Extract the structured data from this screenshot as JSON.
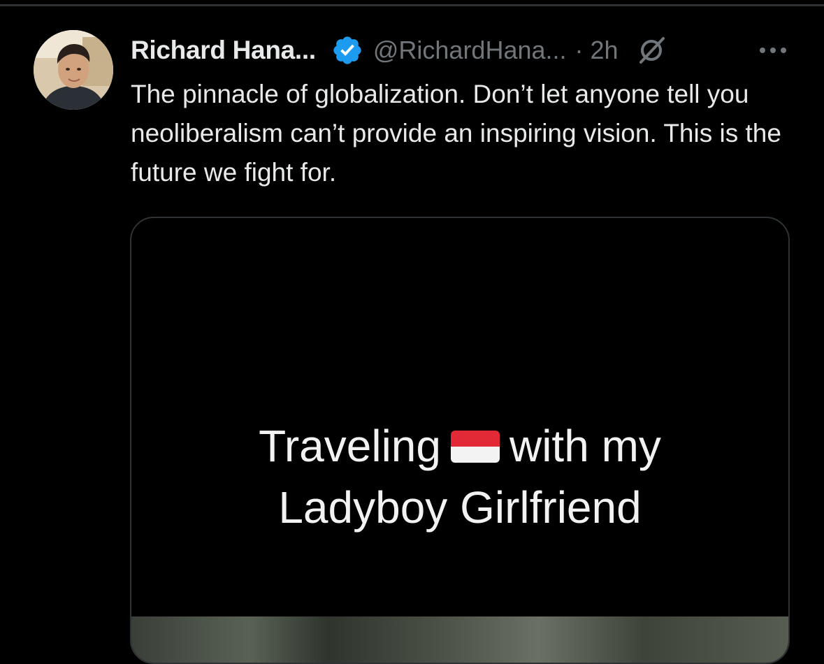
{
  "tweet": {
    "author": {
      "display_name": "Richard Hana...",
      "handle": "@RichardHana...",
      "verified": true,
      "verified_color": "#1d9bf0",
      "avatar_icon": "avatar-photo"
    },
    "separator": "·",
    "time": "2h",
    "grok_icon": "grok-icon",
    "more_icon": "more-horizontal-icon",
    "text": "The pinnacle of globalization. Don’t let anyone tell you neoliberalism can’t provide an inspiring vision. This is the future we fight for.",
    "media": {
      "caption_before_flag": "Traveling",
      "flag_icon": "indonesia-flag-icon",
      "caption_after_flag": "with my",
      "caption_line2": "Ladyboy Girlfriend"
    }
  },
  "colors": {
    "background": "#000000",
    "text_primary": "#e7e9ea",
    "text_secondary": "#71767b",
    "border": "#2f3336"
  }
}
